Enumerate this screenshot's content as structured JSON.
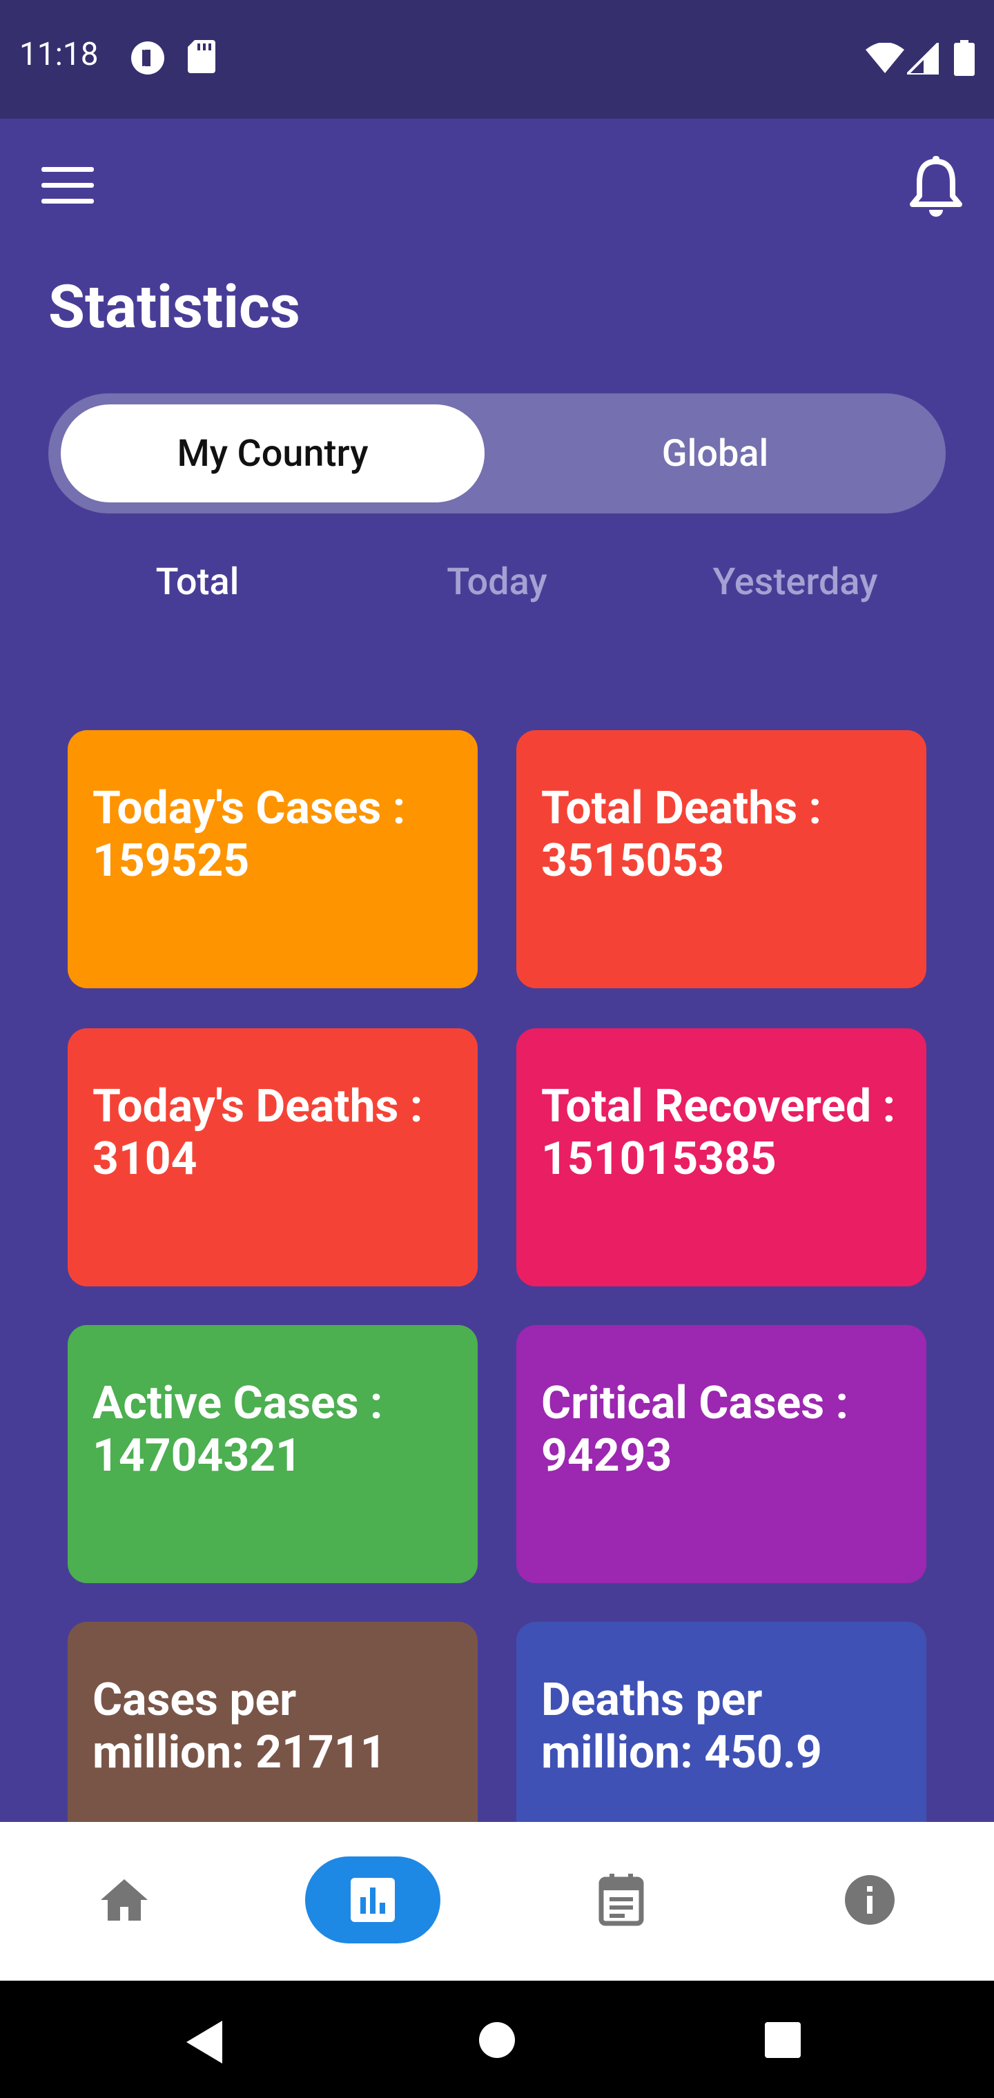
{
  "status_bar": {
    "time": "11:18"
  },
  "header": {
    "title": "Statistics",
    "menu_icon": "hamburger-menu-icon",
    "notification_icon": "bell-icon"
  },
  "scope_toggle": {
    "options": [
      "My Country",
      "Global"
    ],
    "selected": "My Country"
  },
  "period_tabs": {
    "options": [
      "Total",
      "Today",
      "Yesterday"
    ],
    "selected": "Total"
  },
  "cards": [
    {
      "label": "Today's Cases :",
      "value": "159525",
      "color": "#fe9400"
    },
    {
      "label": "Total Deaths :",
      "value": "3515053",
      "color": "#f44336"
    },
    {
      "label": "Today's Deaths :",
      "value": "3104",
      "color": "#f44336"
    },
    {
      "label": "Total Recovered :",
      "value": "151015385",
      "color": "#e91e63"
    },
    {
      "label": "Active Cases :",
      "value": "14704321",
      "color": "#4caf50"
    },
    {
      "label": "Critical Cases :",
      "value": "94293",
      "color": "#9c27b0"
    },
    {
      "label": "Cases per million:",
      "value": "21711",
      "color": "#795548"
    },
    {
      "label": "Deaths per million:",
      "value": "450.9",
      "color": "#3f51b5"
    }
  ],
  "bottom_nav": {
    "items": [
      {
        "icon": "home-icon",
        "active": false
      },
      {
        "icon": "bar-chart-icon",
        "active": true
      },
      {
        "icon": "calendar-icon",
        "active": false
      },
      {
        "icon": "info-icon",
        "active": false
      }
    ]
  },
  "colors": {
    "background": "#483d96",
    "status_bar": "#352f6e",
    "toggle_track": "#7570af",
    "accent": "#1e88e5"
  }
}
